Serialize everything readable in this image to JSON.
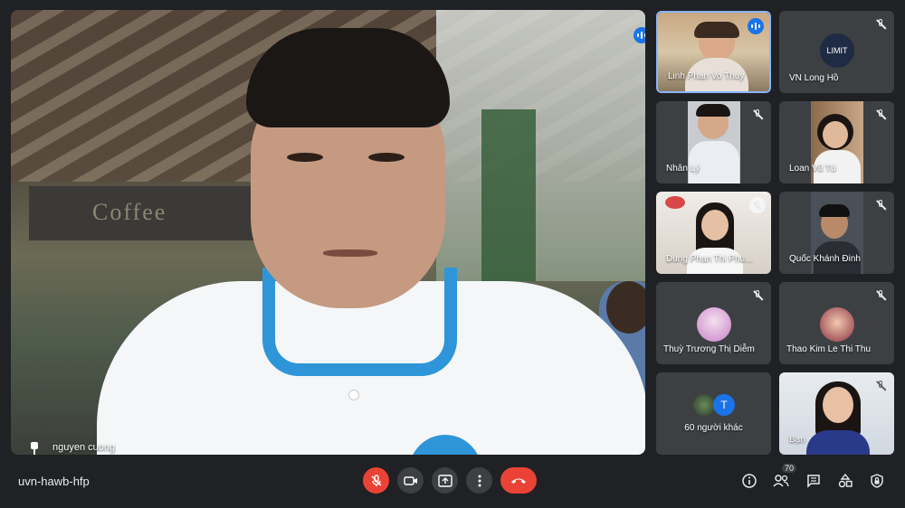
{
  "main": {
    "name": "nguyen cuong",
    "sign_text": "Coffee",
    "speaking": true
  },
  "tiles": [
    {
      "name": "Linh Phan Vo Thuy",
      "state": "speaking"
    },
    {
      "name": "VN Long Hồ",
      "avatar_text": "LIMIT",
      "state": "muted"
    },
    {
      "name": "Nhân Lý",
      "state": "muted"
    },
    {
      "name": "Loan Vũ Tú",
      "state": "muted"
    },
    {
      "name": "Dung Phan Thi Phu...",
      "state": "muted"
    },
    {
      "name": "Quốc Khánh Đinh",
      "state": "muted"
    },
    {
      "name": "Thuỳ Trương Thị Diễm",
      "state": "muted"
    },
    {
      "name": "Thao Kim Le Thi Thu",
      "state": "muted"
    },
    {
      "name": "60 người khác",
      "avatar_text": "T"
    },
    {
      "name": "Bạn",
      "state": "muted"
    }
  ],
  "bottom": {
    "meeting_code": "uvn-hawb-hfp",
    "participants_count": "70",
    "controls": [
      "mic-off",
      "camera",
      "present",
      "more",
      "leave"
    ],
    "right_icons": [
      "info",
      "people",
      "chat",
      "activities",
      "host-controls"
    ]
  },
  "colors": {
    "background": "#202124",
    "tile": "#3c4043",
    "accent": "#1a73e8",
    "danger": "#ea4335"
  }
}
